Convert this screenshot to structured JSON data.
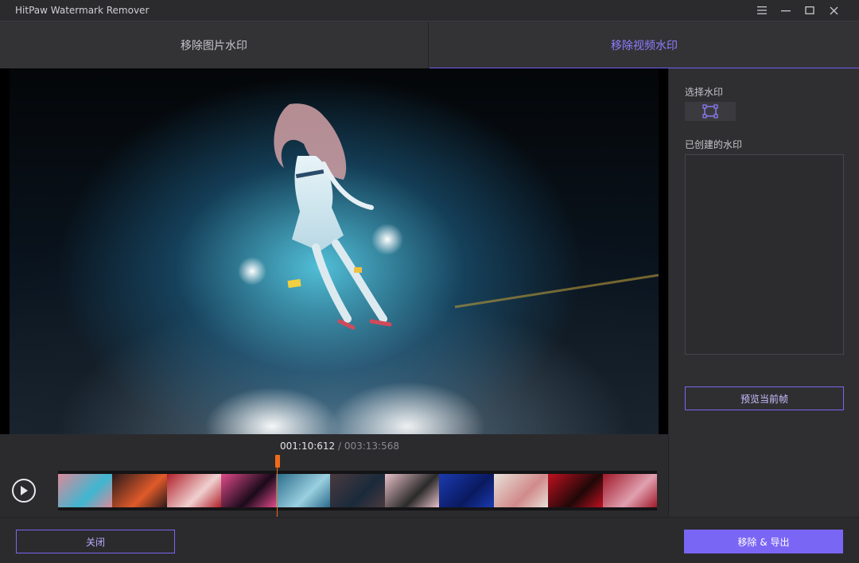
{
  "window": {
    "title": "HitPaw Watermark Remover",
    "controls": [
      "menu-icon",
      "minimize-icon",
      "maximize-icon",
      "close-icon"
    ]
  },
  "tabs": [
    {
      "label": "移除图片水印",
      "active": false
    },
    {
      "label": "移除视频水印",
      "active": true
    }
  ],
  "player": {
    "current_time": "001:10:612",
    "separator": " / ",
    "total_time": "003:13:568",
    "play_icon": "play-icon"
  },
  "sidebar": {
    "select_label": "选择水印",
    "select_tool_icon": "rectangle-select-icon",
    "created_label": "已创建的水印",
    "preview_button": "预览当前帧"
  },
  "footer": {
    "close_button": "关闭",
    "export_button": "移除 & 导出"
  },
  "colors": {
    "accent": "#7a66f5",
    "active_tab": "#8f7dff",
    "playhead": "#f06a1c"
  },
  "filmstrip": [
    [
      "#d98a9a",
      "#3fb6d0"
    ],
    [
      "#2a1a1a",
      "#e05a2a"
    ],
    [
      "#b0202a",
      "#f0d0d0"
    ],
    [
      "#e04a8a",
      "#1a0a1a"
    ],
    [
      "#2a6a8a",
      "#9ad0e0"
    ],
    [
      "#4a3a40",
      "#1a2a3a"
    ],
    [
      "#e8c0c8",
      "#2a2a2a"
    ],
    [
      "#1a3ab0",
      "#0a1a60"
    ],
    [
      "#e8e0d8",
      "#d08a8a"
    ],
    [
      "#c01020",
      "#200808"
    ],
    [
      "#a01828",
      "#e0a0b0"
    ]
  ]
}
